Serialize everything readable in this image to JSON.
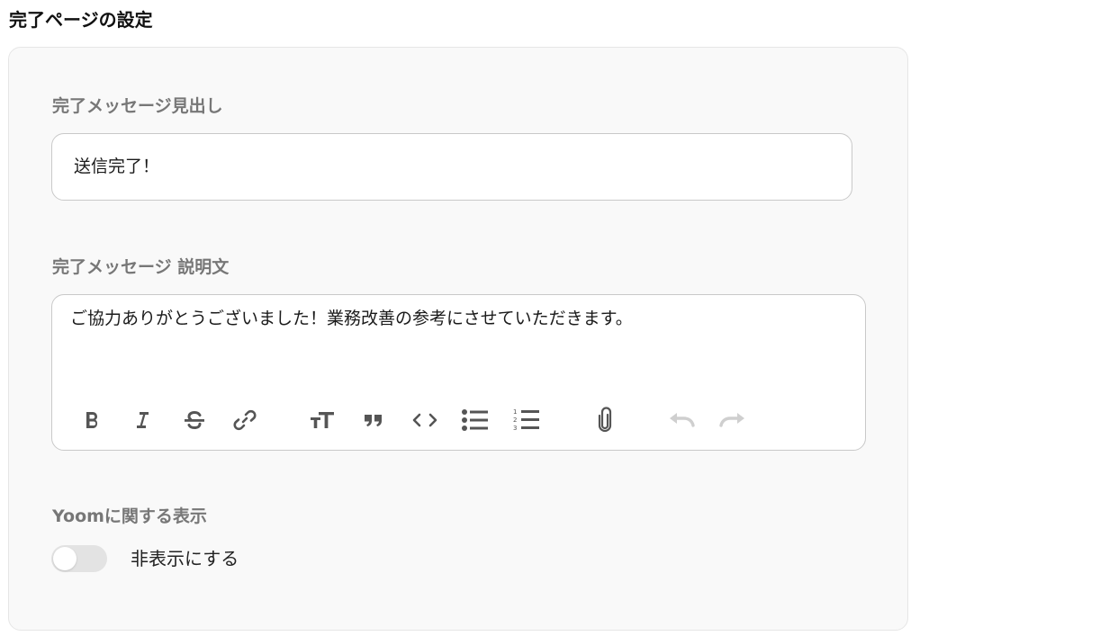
{
  "page": {
    "title": "完了ページの設定"
  },
  "heading_field": {
    "label": "完了メッセージ見出し",
    "value": "送信完了！"
  },
  "description_field": {
    "label": "完了メッセージ 説明文",
    "value": "ご協力ありがとうございました！業務改善の参考にさせていただきます。",
    "toolbar": [
      {
        "name": "bold",
        "icon": "bold-icon",
        "enabled": true
      },
      {
        "name": "italic",
        "icon": "italic-icon",
        "enabled": true
      },
      {
        "name": "strikethrough",
        "icon": "strikethrough-icon",
        "enabled": true
      },
      {
        "name": "link",
        "icon": "link-icon",
        "enabled": true
      },
      {
        "name": "heading",
        "icon": "heading-icon",
        "enabled": true
      },
      {
        "name": "quote",
        "icon": "quote-icon",
        "enabled": true
      },
      {
        "name": "code",
        "icon": "code-icon",
        "enabled": true
      },
      {
        "name": "bullet-list",
        "icon": "bullet-list-icon",
        "enabled": true
      },
      {
        "name": "numbered-list",
        "icon": "numbered-list-icon",
        "enabled": true
      },
      {
        "name": "attach",
        "icon": "paperclip-icon",
        "enabled": true
      },
      {
        "name": "undo",
        "icon": "undo-icon",
        "enabled": false
      },
      {
        "name": "redo",
        "icon": "redo-icon",
        "enabled": false
      }
    ]
  },
  "yoom_display": {
    "label": "Yoomに関する表示",
    "toggle_label": "非表示にする",
    "toggle_on": false
  },
  "colors": {
    "icon": "#555555",
    "icon_disabled": "#cfcfcf",
    "label": "#777777",
    "card_bg": "#f9f9f9"
  }
}
